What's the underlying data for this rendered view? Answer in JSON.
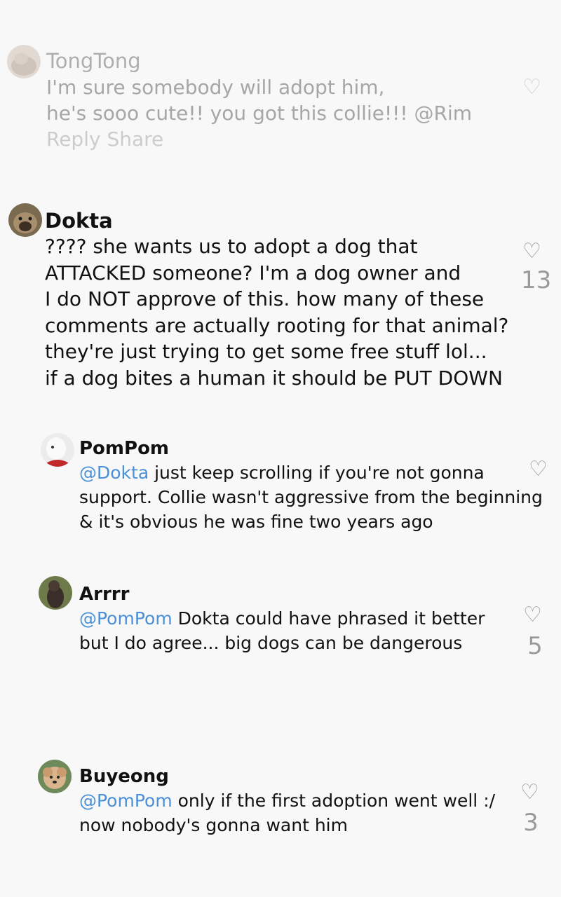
{
  "comments": [
    {
      "user": "TongTong",
      "lines": [
        "I'm sure somebody will adopt him,",
        "he's sooo cute!! you got this collie!!! @Rim"
      ],
      "actions": "Reply Share",
      "likes": ""
    },
    {
      "user": "Dokta",
      "lines": [
        "???? she wants us to adopt a dog that",
        "ATTACKED someone? I'm a dog owner and",
        "I do NOT approve of this. how many of these",
        "comments are actually rooting for that animal?",
        "they're just trying to get some free stuff lol...",
        "if a dog bites a human it should be PUT DOWN"
      ],
      "likes": "13"
    },
    {
      "user": "PomPom",
      "mention": "@Dokta",
      "lines": [
        " just keep scrolling if you're not gonna",
        "support. Collie wasn't aggressive from the beginning",
        "& it's obvious he was fine two years ago"
      ],
      "likes": ""
    },
    {
      "user": "Arrrr",
      "mention": "@PomPom",
      "lines": [
        " Dokta could have phrased it better",
        "but I do agree... big dogs can be dangerous"
      ],
      "likes": "5"
    },
    {
      "user": "Buyeong",
      "mention": "@PomPom",
      "lines": [
        " only if the first adoption went well :/",
        "now nobody's gonna want him"
      ],
      "likes": "3"
    }
  ],
  "icons": {
    "like": "heart-outline-icon",
    "heart_glyph": "♡"
  },
  "colors": {
    "mention": "#4a90d9",
    "muted": "#9a9a9a"
  }
}
